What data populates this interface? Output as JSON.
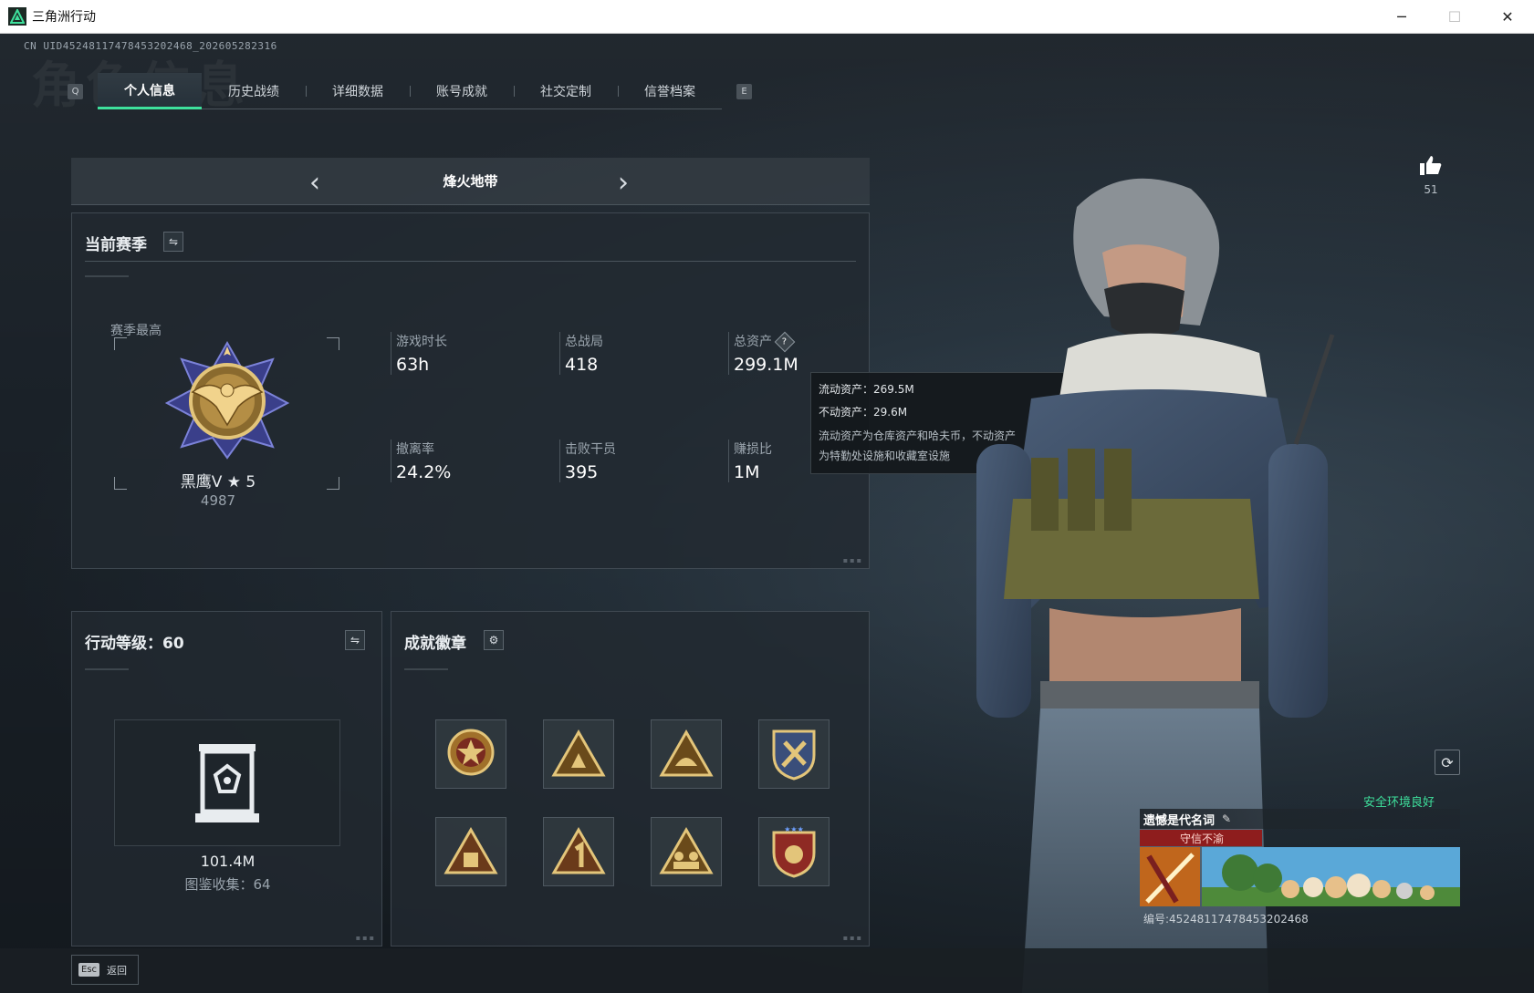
{
  "window": {
    "title": "三角洲行动",
    "minimize": "─",
    "maximize": "☐",
    "close": "✕"
  },
  "uid_line": "CN UID452481174784532024​68_202605282316",
  "watermark": "角色信息",
  "tabs": {
    "left_key": "Q",
    "right_key": "E",
    "items": [
      {
        "label": "个人信息",
        "active": true
      },
      {
        "label": "历史战绩"
      },
      {
        "label": "详细数据"
      },
      {
        "label": "账号成就"
      },
      {
        "label": "社交定制"
      },
      {
        "label": "信誉档案"
      }
    ]
  },
  "mode": {
    "label": "烽火地带",
    "prev": "‹",
    "next": "›"
  },
  "season": {
    "title": "当前赛季",
    "best_label": "赛季最高",
    "rank_name": "黑鹰V ★ 5",
    "rank_score": "4987",
    "stats": [
      {
        "label": "游戏时长",
        "value": "63h"
      },
      {
        "label": "总战局",
        "value": "418"
      },
      {
        "label": "总资产",
        "value": "299.1M"
      },
      {
        "label": "撤离率",
        "value": "24.2%"
      },
      {
        "label": "击败干员",
        "value": "395"
      },
      {
        "label": "赚损比",
        "value": "1M"
      }
    ],
    "help_icon": "?"
  },
  "tooltip": {
    "liquid": "流动资产：269.5M",
    "fixed": "不动资产：29.6M",
    "desc1": "流动资产为仓库资产和哈夫币，不动资产",
    "desc2": "为特勤处设施和收藏室设施"
  },
  "level": {
    "title": "行动等级：60",
    "value": "101.4M",
    "collect": "图鉴收集：64"
  },
  "badges": {
    "title": "成就徽章",
    "settings_icon": "gear-icon"
  },
  "like": {
    "count": "51"
  },
  "profile": {
    "env": "安全环境良好",
    "name": "遗憾是代名词",
    "honor": "守信不渝",
    "id_line": "编号:452481174784532024​68"
  },
  "bottom": {
    "esc_key": "Esc",
    "esc_label": "返回"
  },
  "colors": {
    "accent": "#3ee09c",
    "honor_red": "#8e1d1d"
  }
}
